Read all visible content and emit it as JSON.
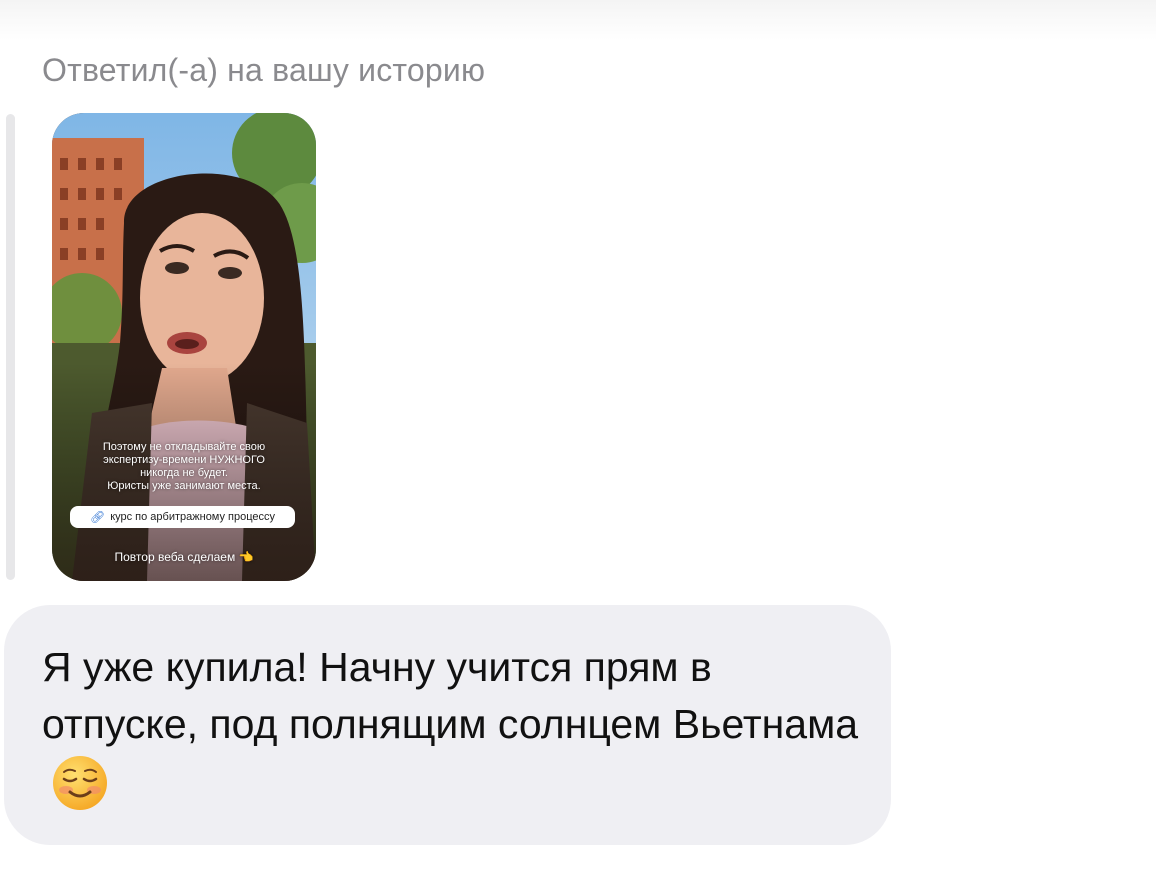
{
  "reply": {
    "header": "Ответил(-а) на вашу историю"
  },
  "story": {
    "text_lines": [
      "Поэтому не откладывайте свою",
      "экспертизу-времени НУЖНОГО",
      "никогда не будет.",
      "Юристы уже занимают места."
    ],
    "link_label": "курс по арбитражному процессу",
    "link_icon": "link-icon",
    "caption": "Повтор веба сделаем"
  },
  "message": {
    "text": "Я уже купила! Начну учится прям в отпуске, под полнящим солнцем Вьетнама",
    "emoji": "smiling-face-icon"
  }
}
